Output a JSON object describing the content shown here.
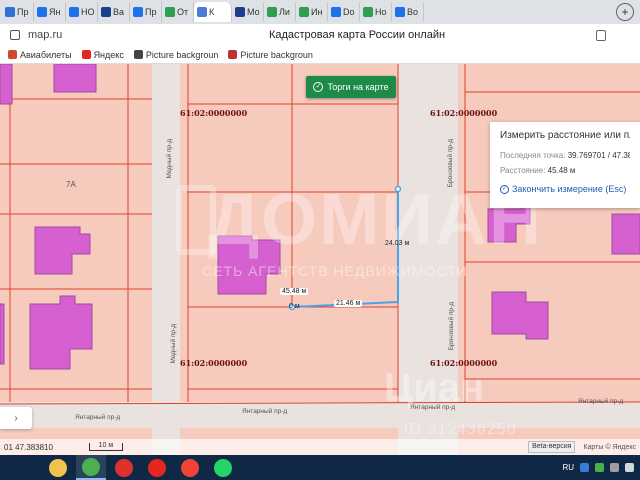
{
  "browser": {
    "tabs": [
      {
        "label": "Пр",
        "color": "#2f6fd6"
      },
      {
        "label": "Ян",
        "color": "#1a73e8"
      },
      {
        "label": "НО",
        "color": "#1a73e8"
      },
      {
        "label": "Ва",
        "color": "#1b3e8f"
      },
      {
        "label": "Пр",
        "color": "#1a73e8"
      },
      {
        "label": "От",
        "color": "#2e9e4f"
      },
      {
        "label": "К",
        "color": "#4c7ad9",
        "active": true
      },
      {
        "label": "Мо",
        "color": "#1b3e8f"
      },
      {
        "label": "Ли",
        "color": "#2e9e4f"
      },
      {
        "label": "Ин",
        "color": "#2e9e4f"
      },
      {
        "label": "Do",
        "color": "#1a73e8"
      },
      {
        "label": "Но",
        "color": "#2e9e4f"
      },
      {
        "label": "Во",
        "color": "#1a73e8"
      }
    ],
    "new_tab": "+",
    "url": "map.ru",
    "page_title": "Кадастровая карта России онлайн",
    "bookmarks": [
      {
        "label": "Авиабилеты",
        "color": "#d04a2c"
      },
      {
        "label": "Яндекс",
        "color": "#e52620"
      },
      {
        "label": "Picture backgroun",
        "color": "#444"
      },
      {
        "label": "Picture backgroun",
        "color": "#b33"
      }
    ]
  },
  "map": {
    "torgi_button": "Торги на карте",
    "cadastral_labels": [
      "61:02:0000000",
      "61:02:0000000",
      "61:02:0000000",
      "61:02:0000000"
    ],
    "parcel_number": "7А",
    "streets": {
      "medny": "Медный пр-д",
      "medny_lower": "Медный пр-д",
      "bronzovy": "Бронзовый пр-д",
      "bronzovy_lower": "Бронзовый пр-д",
      "yantarny_1": "Янтарный пр-д",
      "yantarny_2": "Янтарный пр-д",
      "yantarny_3": "Янтарный пр-д",
      "yantarny_4": "Янтарный пр-д"
    },
    "measurements": {
      "vertical": "24.03 м",
      "horizontal": "21.46 м",
      "total": "45.48 м",
      "start": "0 м"
    },
    "measure_panel": {
      "title": "Измерить расстояние или площ",
      "last_point_label": "Последняя точка:",
      "last_point_value": "39.769701 / 47.38",
      "distance_label": "Расстояние:",
      "distance_value": "45.48 м",
      "finish_label": "Закончить измерение (Esc)"
    },
    "coord_toggle": "›",
    "bottom": {
      "coords": "01  47.383810",
      "scale": "10 м",
      "beta": "Beta-версия",
      "attribution": "Карты © Яндекс"
    },
    "watermark": {
      "brand": "ДОМИАН",
      "tagline": "СЕТЬ АГЕНТСТВ НЕДВИЖИМОСТИ",
      "cian": "Циан",
      "cian_id": "ID 312436250"
    },
    "colors": {
      "parcel_fill": "#f6cbbe",
      "parcel_border": "#e0402a",
      "building_fill": "#d660d0",
      "measure_line": "#4aa3e6",
      "button_green": "#1e8a47"
    }
  },
  "taskbar": {
    "apps": [
      {
        "name": "Explorer",
        "color": "#f2c14e"
      },
      {
        "name": "Chrome",
        "color": "#4caf50",
        "active": true
      },
      {
        "name": "Opera",
        "color": "#e0312f"
      },
      {
        "name": "Yandex",
        "color": "#e52620"
      },
      {
        "name": "AnyDesk",
        "color": "#ef4436"
      },
      {
        "name": "WhatsApp",
        "color": "#25d366"
      }
    ],
    "lang": "RU"
  }
}
